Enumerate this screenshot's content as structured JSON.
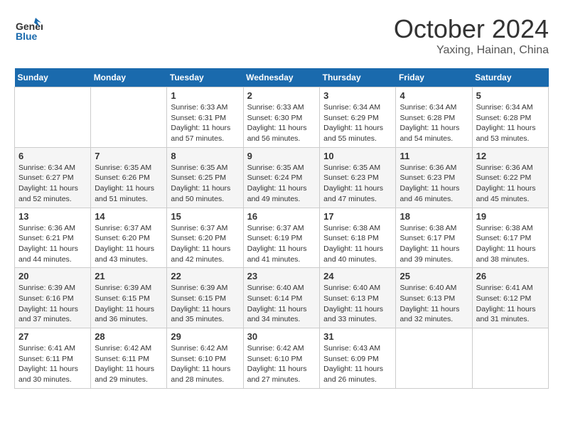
{
  "logo": {
    "general": "General",
    "blue": "Blue"
  },
  "title": "October 2024",
  "location": "Yaxing, Hainan, China",
  "days_header": [
    "Sunday",
    "Monday",
    "Tuesday",
    "Wednesday",
    "Thursday",
    "Friday",
    "Saturday"
  ],
  "weeks": [
    [
      {
        "day": "",
        "info": ""
      },
      {
        "day": "",
        "info": ""
      },
      {
        "day": "1",
        "info": "Sunrise: 6:33 AM\nSunset: 6:31 PM\nDaylight: 11 hours and 57 minutes."
      },
      {
        "day": "2",
        "info": "Sunrise: 6:33 AM\nSunset: 6:30 PM\nDaylight: 11 hours and 56 minutes."
      },
      {
        "day": "3",
        "info": "Sunrise: 6:34 AM\nSunset: 6:29 PM\nDaylight: 11 hours and 55 minutes."
      },
      {
        "day": "4",
        "info": "Sunrise: 6:34 AM\nSunset: 6:28 PM\nDaylight: 11 hours and 54 minutes."
      },
      {
        "day": "5",
        "info": "Sunrise: 6:34 AM\nSunset: 6:28 PM\nDaylight: 11 hours and 53 minutes."
      }
    ],
    [
      {
        "day": "6",
        "info": "Sunrise: 6:34 AM\nSunset: 6:27 PM\nDaylight: 11 hours and 52 minutes."
      },
      {
        "day": "7",
        "info": "Sunrise: 6:35 AM\nSunset: 6:26 PM\nDaylight: 11 hours and 51 minutes."
      },
      {
        "day": "8",
        "info": "Sunrise: 6:35 AM\nSunset: 6:25 PM\nDaylight: 11 hours and 50 minutes."
      },
      {
        "day": "9",
        "info": "Sunrise: 6:35 AM\nSunset: 6:24 PM\nDaylight: 11 hours and 49 minutes."
      },
      {
        "day": "10",
        "info": "Sunrise: 6:35 AM\nSunset: 6:23 PM\nDaylight: 11 hours and 47 minutes."
      },
      {
        "day": "11",
        "info": "Sunrise: 6:36 AM\nSunset: 6:23 PM\nDaylight: 11 hours and 46 minutes."
      },
      {
        "day": "12",
        "info": "Sunrise: 6:36 AM\nSunset: 6:22 PM\nDaylight: 11 hours and 45 minutes."
      }
    ],
    [
      {
        "day": "13",
        "info": "Sunrise: 6:36 AM\nSunset: 6:21 PM\nDaylight: 11 hours and 44 minutes."
      },
      {
        "day": "14",
        "info": "Sunrise: 6:37 AM\nSunset: 6:20 PM\nDaylight: 11 hours and 43 minutes."
      },
      {
        "day": "15",
        "info": "Sunrise: 6:37 AM\nSunset: 6:20 PM\nDaylight: 11 hours and 42 minutes."
      },
      {
        "day": "16",
        "info": "Sunrise: 6:37 AM\nSunset: 6:19 PM\nDaylight: 11 hours and 41 minutes."
      },
      {
        "day": "17",
        "info": "Sunrise: 6:38 AM\nSunset: 6:18 PM\nDaylight: 11 hours and 40 minutes."
      },
      {
        "day": "18",
        "info": "Sunrise: 6:38 AM\nSunset: 6:17 PM\nDaylight: 11 hours and 39 minutes."
      },
      {
        "day": "19",
        "info": "Sunrise: 6:38 AM\nSunset: 6:17 PM\nDaylight: 11 hours and 38 minutes."
      }
    ],
    [
      {
        "day": "20",
        "info": "Sunrise: 6:39 AM\nSunset: 6:16 PM\nDaylight: 11 hours and 37 minutes."
      },
      {
        "day": "21",
        "info": "Sunrise: 6:39 AM\nSunset: 6:15 PM\nDaylight: 11 hours and 36 minutes."
      },
      {
        "day": "22",
        "info": "Sunrise: 6:39 AM\nSunset: 6:15 PM\nDaylight: 11 hours and 35 minutes."
      },
      {
        "day": "23",
        "info": "Sunrise: 6:40 AM\nSunset: 6:14 PM\nDaylight: 11 hours and 34 minutes."
      },
      {
        "day": "24",
        "info": "Sunrise: 6:40 AM\nSunset: 6:13 PM\nDaylight: 11 hours and 33 minutes."
      },
      {
        "day": "25",
        "info": "Sunrise: 6:40 AM\nSunset: 6:13 PM\nDaylight: 11 hours and 32 minutes."
      },
      {
        "day": "26",
        "info": "Sunrise: 6:41 AM\nSunset: 6:12 PM\nDaylight: 11 hours and 31 minutes."
      }
    ],
    [
      {
        "day": "27",
        "info": "Sunrise: 6:41 AM\nSunset: 6:11 PM\nDaylight: 11 hours and 30 minutes."
      },
      {
        "day": "28",
        "info": "Sunrise: 6:42 AM\nSunset: 6:11 PM\nDaylight: 11 hours and 29 minutes."
      },
      {
        "day": "29",
        "info": "Sunrise: 6:42 AM\nSunset: 6:10 PM\nDaylight: 11 hours and 28 minutes."
      },
      {
        "day": "30",
        "info": "Sunrise: 6:42 AM\nSunset: 6:10 PM\nDaylight: 11 hours and 27 minutes."
      },
      {
        "day": "31",
        "info": "Sunrise: 6:43 AM\nSunset: 6:09 PM\nDaylight: 11 hours and 26 minutes."
      },
      {
        "day": "",
        "info": ""
      },
      {
        "day": "",
        "info": ""
      }
    ]
  ]
}
